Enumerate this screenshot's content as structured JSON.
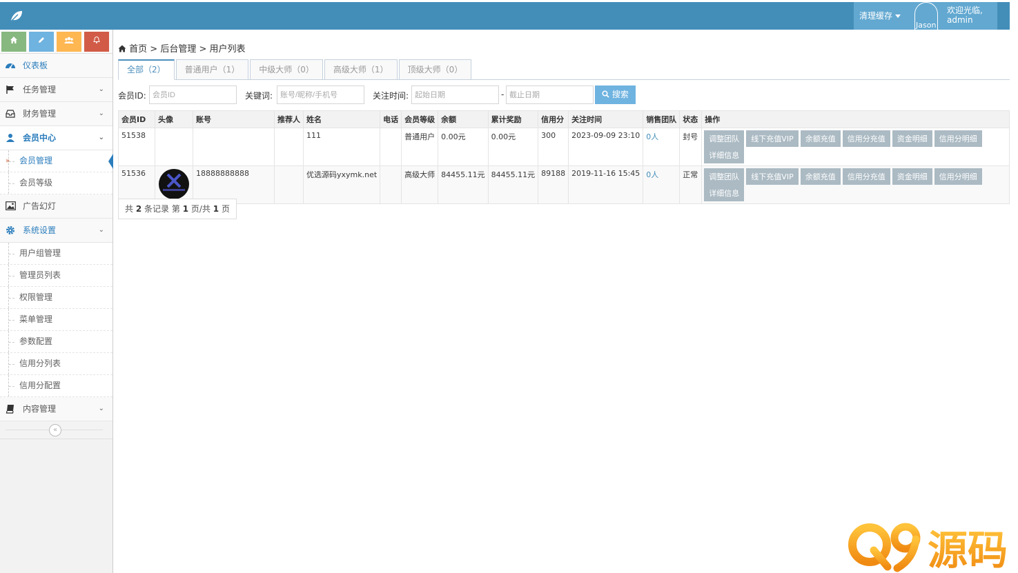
{
  "navbar": {
    "clear_cache": "清理缓存",
    "avatar_name": "Jason",
    "welcome": "欢迎光临,",
    "username": "admin"
  },
  "sidebar": {
    "shortcuts": [
      "home-icon",
      "pencil-icon",
      "users-icon",
      "bell-icon"
    ],
    "items": {
      "dashboard": "仪表板",
      "tasks": "任务管理",
      "finance": "财务管理",
      "members": "会员中心",
      "member_manage": "会员管理",
      "member_level": "会员等级",
      "ads": "广告幻灯",
      "system": "系统设置",
      "user_group": "用户组管理",
      "admin_list": "管理员列表",
      "permission": "权限管理",
      "menu": "菜单管理",
      "params": "参数配置",
      "credit_list": "信用分列表",
      "credit_config": "信用分配置",
      "content": "内容管理"
    }
  },
  "breadcrumb": {
    "home": "首页",
    "sep": ">",
    "admin": "后台管理",
    "current": "用户列表"
  },
  "tabs": [
    "全部（2）",
    "普通用户（1）",
    "中级大师（0）",
    "高级大师（1）",
    "顶级大师（0）"
  ],
  "filter": {
    "member_id_label": "会员ID:",
    "member_id_placeholder": "会员ID",
    "keyword_label": "关键词:",
    "keyword_placeholder": "账号/昵称/手机号",
    "time_label": "关注时间:",
    "start_placeholder": "起始日期",
    "dash": "-",
    "end_placeholder": "截止日期",
    "search": "搜索"
  },
  "table": {
    "headers": [
      "会员ID",
      "头像",
      "账号",
      "推荐人",
      "姓名",
      "电话",
      "会员等级",
      "余额",
      "累计奖励",
      "信用分",
      "关注时间",
      "销售团队",
      "状态",
      "操作"
    ],
    "rows": [
      {
        "id": "51538",
        "account": "",
        "referrer": "",
        "name": "111",
        "phone": "",
        "level": "普通用户",
        "balance": "0.00元",
        "reward": "0.00元",
        "credit": "300",
        "time": "2023-09-09 23:10",
        "team": "0人",
        "status": "封号"
      },
      {
        "id": "51536",
        "account": "18888888888",
        "referrer": "",
        "name": "优选源码yxymk.net",
        "phone": "",
        "level": "高级大师",
        "balance": "84455.11元",
        "reward": "84455.11元",
        "credit": "89188",
        "time": "2019-11-16 15:45",
        "team": "0人",
        "status": "正常"
      }
    ],
    "actions": [
      "调整团队",
      "线下充值VIP",
      "余额充值",
      "信用分充值",
      "资金明细",
      "信用分明细",
      "详细信息"
    ]
  },
  "pager": {
    "pre": "共",
    "total": "2",
    "mid1": "条记录 第",
    "page": "1",
    "mid2": "页/共",
    "pages": "1",
    "post": "页"
  },
  "watermark": "Q9源码",
  "colors": {
    "navbar": "#438eb9",
    "nav_button": "#62a8d1",
    "active": "#2b7dbc",
    "action_button": "#abbac3",
    "search_button": "#6fb3e0",
    "watermark": "#f39a1e"
  }
}
